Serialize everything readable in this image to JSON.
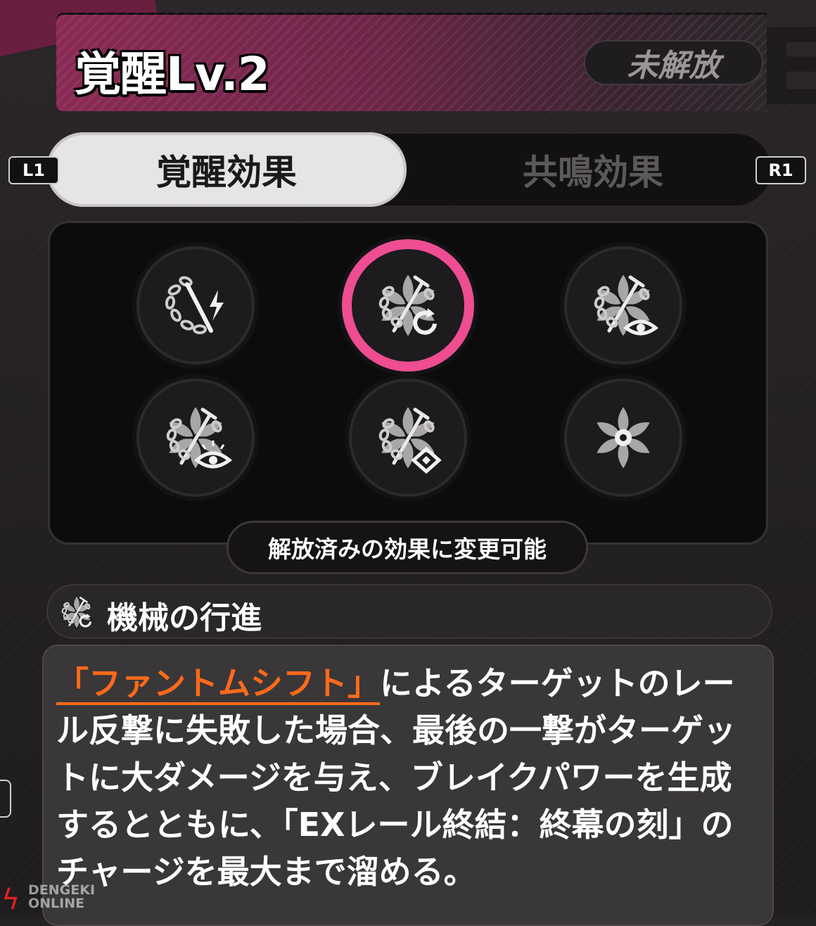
{
  "header": {
    "title": "覚醒Lv.2",
    "status": "未解放"
  },
  "tabs": {
    "left_key": "L1",
    "right_key": "R1",
    "items": [
      {
        "label": "覚醒効果",
        "active": true
      },
      {
        "label": "共鳴効果",
        "active": false
      }
    ]
  },
  "grid": {
    "slots": [
      {
        "icon": "chain-sword-lightning-icon",
        "selected": false
      },
      {
        "icon": "chain-sword-rotate-icon",
        "selected": true
      },
      {
        "icon": "chain-sword-eye-icon",
        "selected": false
      },
      {
        "icon": "chain-sword-eye-sun-icon",
        "selected": false
      },
      {
        "icon": "chain-sword-diamond-icon",
        "selected": false
      },
      {
        "icon": "flower-icon",
        "selected": false
      }
    ],
    "hint": "解放済みの効果に変更可能"
  },
  "effect": {
    "icon": "chain-sword-rotate-icon",
    "name": "機械の行進",
    "keyword": "「ファントムシフト」",
    "description": "によるターゲットのレール反撃に失敗した場合、最後の一撃がターゲットに大ダメージを与え、ブレイクパワーを生成するとともに、「EXレール終結：終幕の刻」のチャージを最大まで溜める。"
  },
  "watermark": {
    "line1": "DENGEKI",
    "line2": "ONLINE"
  },
  "colors": {
    "accent": "#ef4d91",
    "keyword": "#ff6a1a",
    "header": "#8a2a55"
  }
}
